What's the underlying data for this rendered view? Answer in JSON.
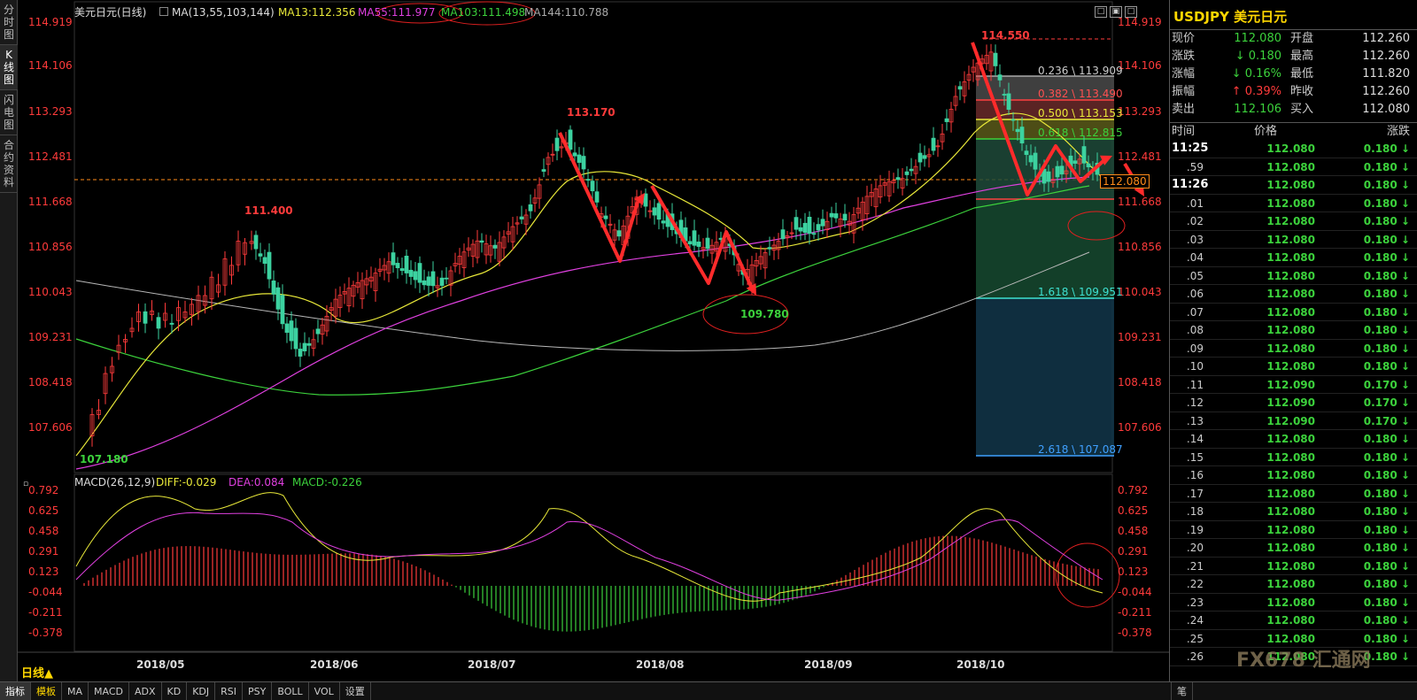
{
  "left_tabs": [
    "分\n时\n图",
    "K\n线\n图",
    "闪\n电\n图",
    "合\n约\n资\n料"
  ],
  "header": {
    "symbol_label": "美元日元(日线)",
    "ma_label": "MA(13,55,103,144)",
    "ma13": "MA13:112.356",
    "ma55": "MA55:111.977",
    "ma103": "MA103:111.498",
    "ma144": "MA144:110.788"
  },
  "window_buttons": [
    "□",
    "▣",
    "□"
  ],
  "price_axis": [
    "114.919",
    "114.106",
    "113.293",
    "112.481",
    "111.668",
    "110.856",
    "110.043",
    "109.231",
    "108.418",
    "107.606"
  ],
  "current_price_tag": "112.080",
  "annotations": {
    "high": "114.550",
    "peak_july": "113.170",
    "peak_may": "111.400",
    "low_aug": "109.780",
    "low_start": "107.180"
  },
  "fibonacci": [
    {
      "label": "0.236 \\ 113.909",
      "color": "#aaaaaa"
    },
    {
      "label": "0.382 \\ 113.490",
      "color": "#ff4040"
    },
    {
      "label": "0.500 \\ 113.153",
      "color": "#e8e839"
    },
    {
      "label": "0.618 \\ 112.815",
      "color": "#3cd23c"
    },
    {
      "label": "1.618 \\ 109.951",
      "color": "#3ee0d0"
    },
    {
      "label": "2.618 \\ 107.087",
      "color": "#3fa0ff"
    }
  ],
  "macd": {
    "title": "MACD(26,12,9)",
    "diff": "DIFF:-0.029",
    "dea": "DEA:0.084",
    "macd": "MACD:-0.226",
    "axis": [
      "0.792",
      "0.625",
      "0.458",
      "0.291",
      "0.123",
      "-0.044",
      "-0.211",
      "-0.378"
    ]
  },
  "date_axis": [
    "2018/05",
    "2018/06",
    "2018/07",
    "2018/08",
    "2018/09",
    "2018/10"
  ],
  "period_button": "日线▲",
  "bottom_tabs": [
    "指标",
    "模板",
    "MA",
    "MACD",
    "ADX",
    "KD",
    "KDJ",
    "RSI",
    "PSY",
    "BOLL",
    "VOL",
    "设置"
  ],
  "quote": {
    "title": "USDJPY 美元日元",
    "rows": [
      {
        "k": "现价",
        "v": "112.080",
        "vcolor": "#3cd23c",
        "k2": "开盘",
        "v2": "112.260"
      },
      {
        "k": "涨跌",
        "v": "↓ 0.180",
        "vcolor": "#3cd23c",
        "k2": "最高",
        "v2": "112.260"
      },
      {
        "k": "涨幅",
        "v": "↓ 0.16%",
        "vcolor": "#3cd23c",
        "k2": "最低",
        "v2": "111.820"
      },
      {
        "k": "振幅",
        "v": "↑ 0.39%",
        "vcolor": "#ff3b3b",
        "k2": "昨收",
        "v2": "112.260"
      },
      {
        "k": "卖出",
        "v": "112.106",
        "vcolor": "#3cd23c",
        "k2": "买入",
        "v2": "112.080"
      }
    ],
    "tick_header": {
      "time": "时间",
      "price": "价格",
      "change": "涨跌"
    },
    "ticks": [
      {
        "t": "11:25",
        "p": "112.080",
        "c": "0.180 ↓",
        "big": true
      },
      {
        "t": ".59",
        "p": "112.080",
        "c": "0.180 ↓"
      },
      {
        "t": "11:26",
        "p": "112.080",
        "c": "0.180 ↓",
        "big": true
      },
      {
        "t": ".01",
        "p": "112.080",
        "c": "0.180 ↓"
      },
      {
        "t": ".02",
        "p": "112.080",
        "c": "0.180 ↓"
      },
      {
        "t": ".03",
        "p": "112.080",
        "c": "0.180 ↓"
      },
      {
        "t": ".04",
        "p": "112.080",
        "c": "0.180 ↓"
      },
      {
        "t": ".05",
        "p": "112.080",
        "c": "0.180 ↓"
      },
      {
        "t": ".06",
        "p": "112.080",
        "c": "0.180 ↓"
      },
      {
        "t": ".07",
        "p": "112.080",
        "c": "0.180 ↓"
      },
      {
        "t": ".08",
        "p": "112.080",
        "c": "0.180 ↓"
      },
      {
        "t": ".09",
        "p": "112.080",
        "c": "0.180 ↓"
      },
      {
        "t": ".10",
        "p": "112.080",
        "c": "0.180 ↓"
      },
      {
        "t": ".11",
        "p": "112.090",
        "c": "0.170 ↓"
      },
      {
        "t": ".12",
        "p": "112.090",
        "c": "0.170 ↓"
      },
      {
        "t": ".13",
        "p": "112.090",
        "c": "0.170 ↓"
      },
      {
        "t": ".14",
        "p": "112.080",
        "c": "0.180 ↓"
      },
      {
        "t": ".15",
        "p": "112.080",
        "c": "0.180 ↓"
      },
      {
        "t": ".16",
        "p": "112.080",
        "c": "0.180 ↓"
      },
      {
        "t": ".17",
        "p": "112.080",
        "c": "0.180 ↓"
      },
      {
        "t": ".18",
        "p": "112.080",
        "c": "0.180 ↓"
      },
      {
        "t": ".19",
        "p": "112.080",
        "c": "0.180 ↓"
      },
      {
        "t": ".20",
        "p": "112.080",
        "c": "0.180 ↓"
      },
      {
        "t": ".21",
        "p": "112.080",
        "c": "0.180 ↓"
      },
      {
        "t": ".22",
        "p": "112.080",
        "c": "0.180 ↓"
      },
      {
        "t": ".23",
        "p": "112.080",
        "c": "0.180 ↓"
      },
      {
        "t": ".24",
        "p": "112.080",
        "c": "0.180 ↓"
      },
      {
        "t": ".25",
        "p": "112.080",
        "c": "0.180 ↓"
      },
      {
        "t": ".26",
        "p": "112.080",
        "c": "0.180 ↓"
      }
    ]
  },
  "watermark": "FX678 汇通网",
  "corner_label": "笔"
}
